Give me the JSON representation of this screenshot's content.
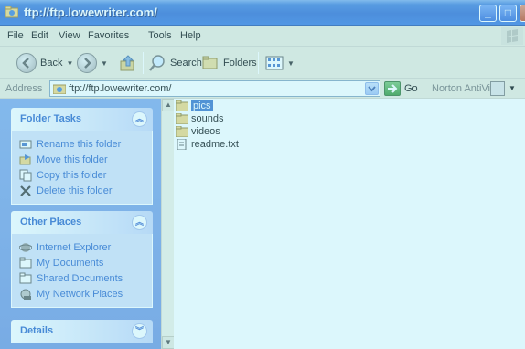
{
  "window": {
    "title": "ftp://ftp.lowewriter.com/"
  },
  "menu": [
    {
      "label": "File"
    },
    {
      "label": "Edit"
    },
    {
      "label": "View"
    },
    {
      "label": "Favorites"
    },
    {
      "label": "Tools"
    },
    {
      "label": "Help"
    }
  ],
  "toolbar": {
    "back_label": "Back",
    "search_label": "Search",
    "folders_label": "Folders"
  },
  "address": {
    "label": "Address",
    "value": "ftp://ftp.lowewriter.com/",
    "go_label": "Go",
    "norton_label": "Norton AntiVirus"
  },
  "folder_tasks": {
    "title": "Folder Tasks",
    "items": [
      {
        "label": "Rename this folder",
        "icon": "rename-icon"
      },
      {
        "label": "Move this folder",
        "icon": "move-icon"
      },
      {
        "label": "Copy this folder",
        "icon": "copy-icon"
      },
      {
        "label": "Delete this folder",
        "icon": "delete-icon"
      }
    ]
  },
  "other_places": {
    "title": "Other Places",
    "items": [
      {
        "label": "Internet Explorer",
        "icon": "internet-explorer-icon"
      },
      {
        "label": "My Documents",
        "icon": "my-documents-icon"
      },
      {
        "label": "Shared Documents",
        "icon": "shared-documents-icon"
      },
      {
        "label": "My Network Places",
        "icon": "network-places-icon"
      }
    ]
  },
  "details": {
    "title": "Details"
  },
  "files": [
    {
      "name": "pics",
      "type": "folder",
      "selected": true
    },
    {
      "name": "sounds",
      "type": "folder",
      "selected": false
    },
    {
      "name": "videos",
      "type": "folder",
      "selected": false
    },
    {
      "name": "readme.txt",
      "type": "text-file",
      "selected": false
    }
  ],
  "colors": {
    "titlebar": "#2a63cf",
    "taskpane": "#6b8fdc",
    "link": "#215dc6",
    "selection": "#316ac5",
    "overlay": "#96e6f5"
  }
}
